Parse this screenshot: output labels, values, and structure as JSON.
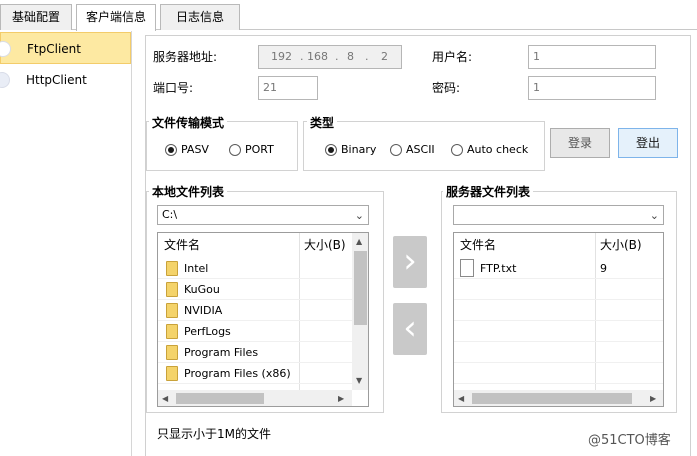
{
  "tabs": [
    "基础配置",
    "客户端信息",
    "日志信息"
  ],
  "sidebar": {
    "items": [
      "FtpClient",
      "HttpClient"
    ]
  },
  "conn": {
    "server_label": "服务器地址:",
    "ip": [
      "192",
      "168",
      "8",
      "2"
    ],
    "ip_dot": ".",
    "username_label": "用户名:",
    "username_value": "1",
    "port_label": "端口号:",
    "port_value": "21",
    "password_label": "密码:",
    "password_value": "1"
  },
  "transfer_mode": {
    "title": "文件传输模式",
    "options": [
      "PASV",
      "PORT"
    ],
    "selected": "PASV"
  },
  "type_group": {
    "title": "类型",
    "options": [
      "Binary",
      "ASCII",
      "Auto check"
    ],
    "selected": "Binary"
  },
  "buttons": {
    "login": "登录",
    "logout": "登出"
  },
  "local": {
    "title": "本地文件列表",
    "path": "C:\\",
    "col_name": "文件名",
    "col_size": "大小(B)",
    "files": [
      "Intel",
      "KuGou",
      "NVIDIA",
      "PerfLogs",
      "Program Files",
      "Program Files (x86)"
    ]
  },
  "server": {
    "title": "服务器文件列表",
    "path": "",
    "col_name": "文件名",
    "col_size": "大小(B)",
    "files": [
      {
        "name": "FTP.txt",
        "size": "9"
      }
    ]
  },
  "footer": {
    "note": "只显示小于1M的文件",
    "watermark": "@51CTO博客"
  }
}
